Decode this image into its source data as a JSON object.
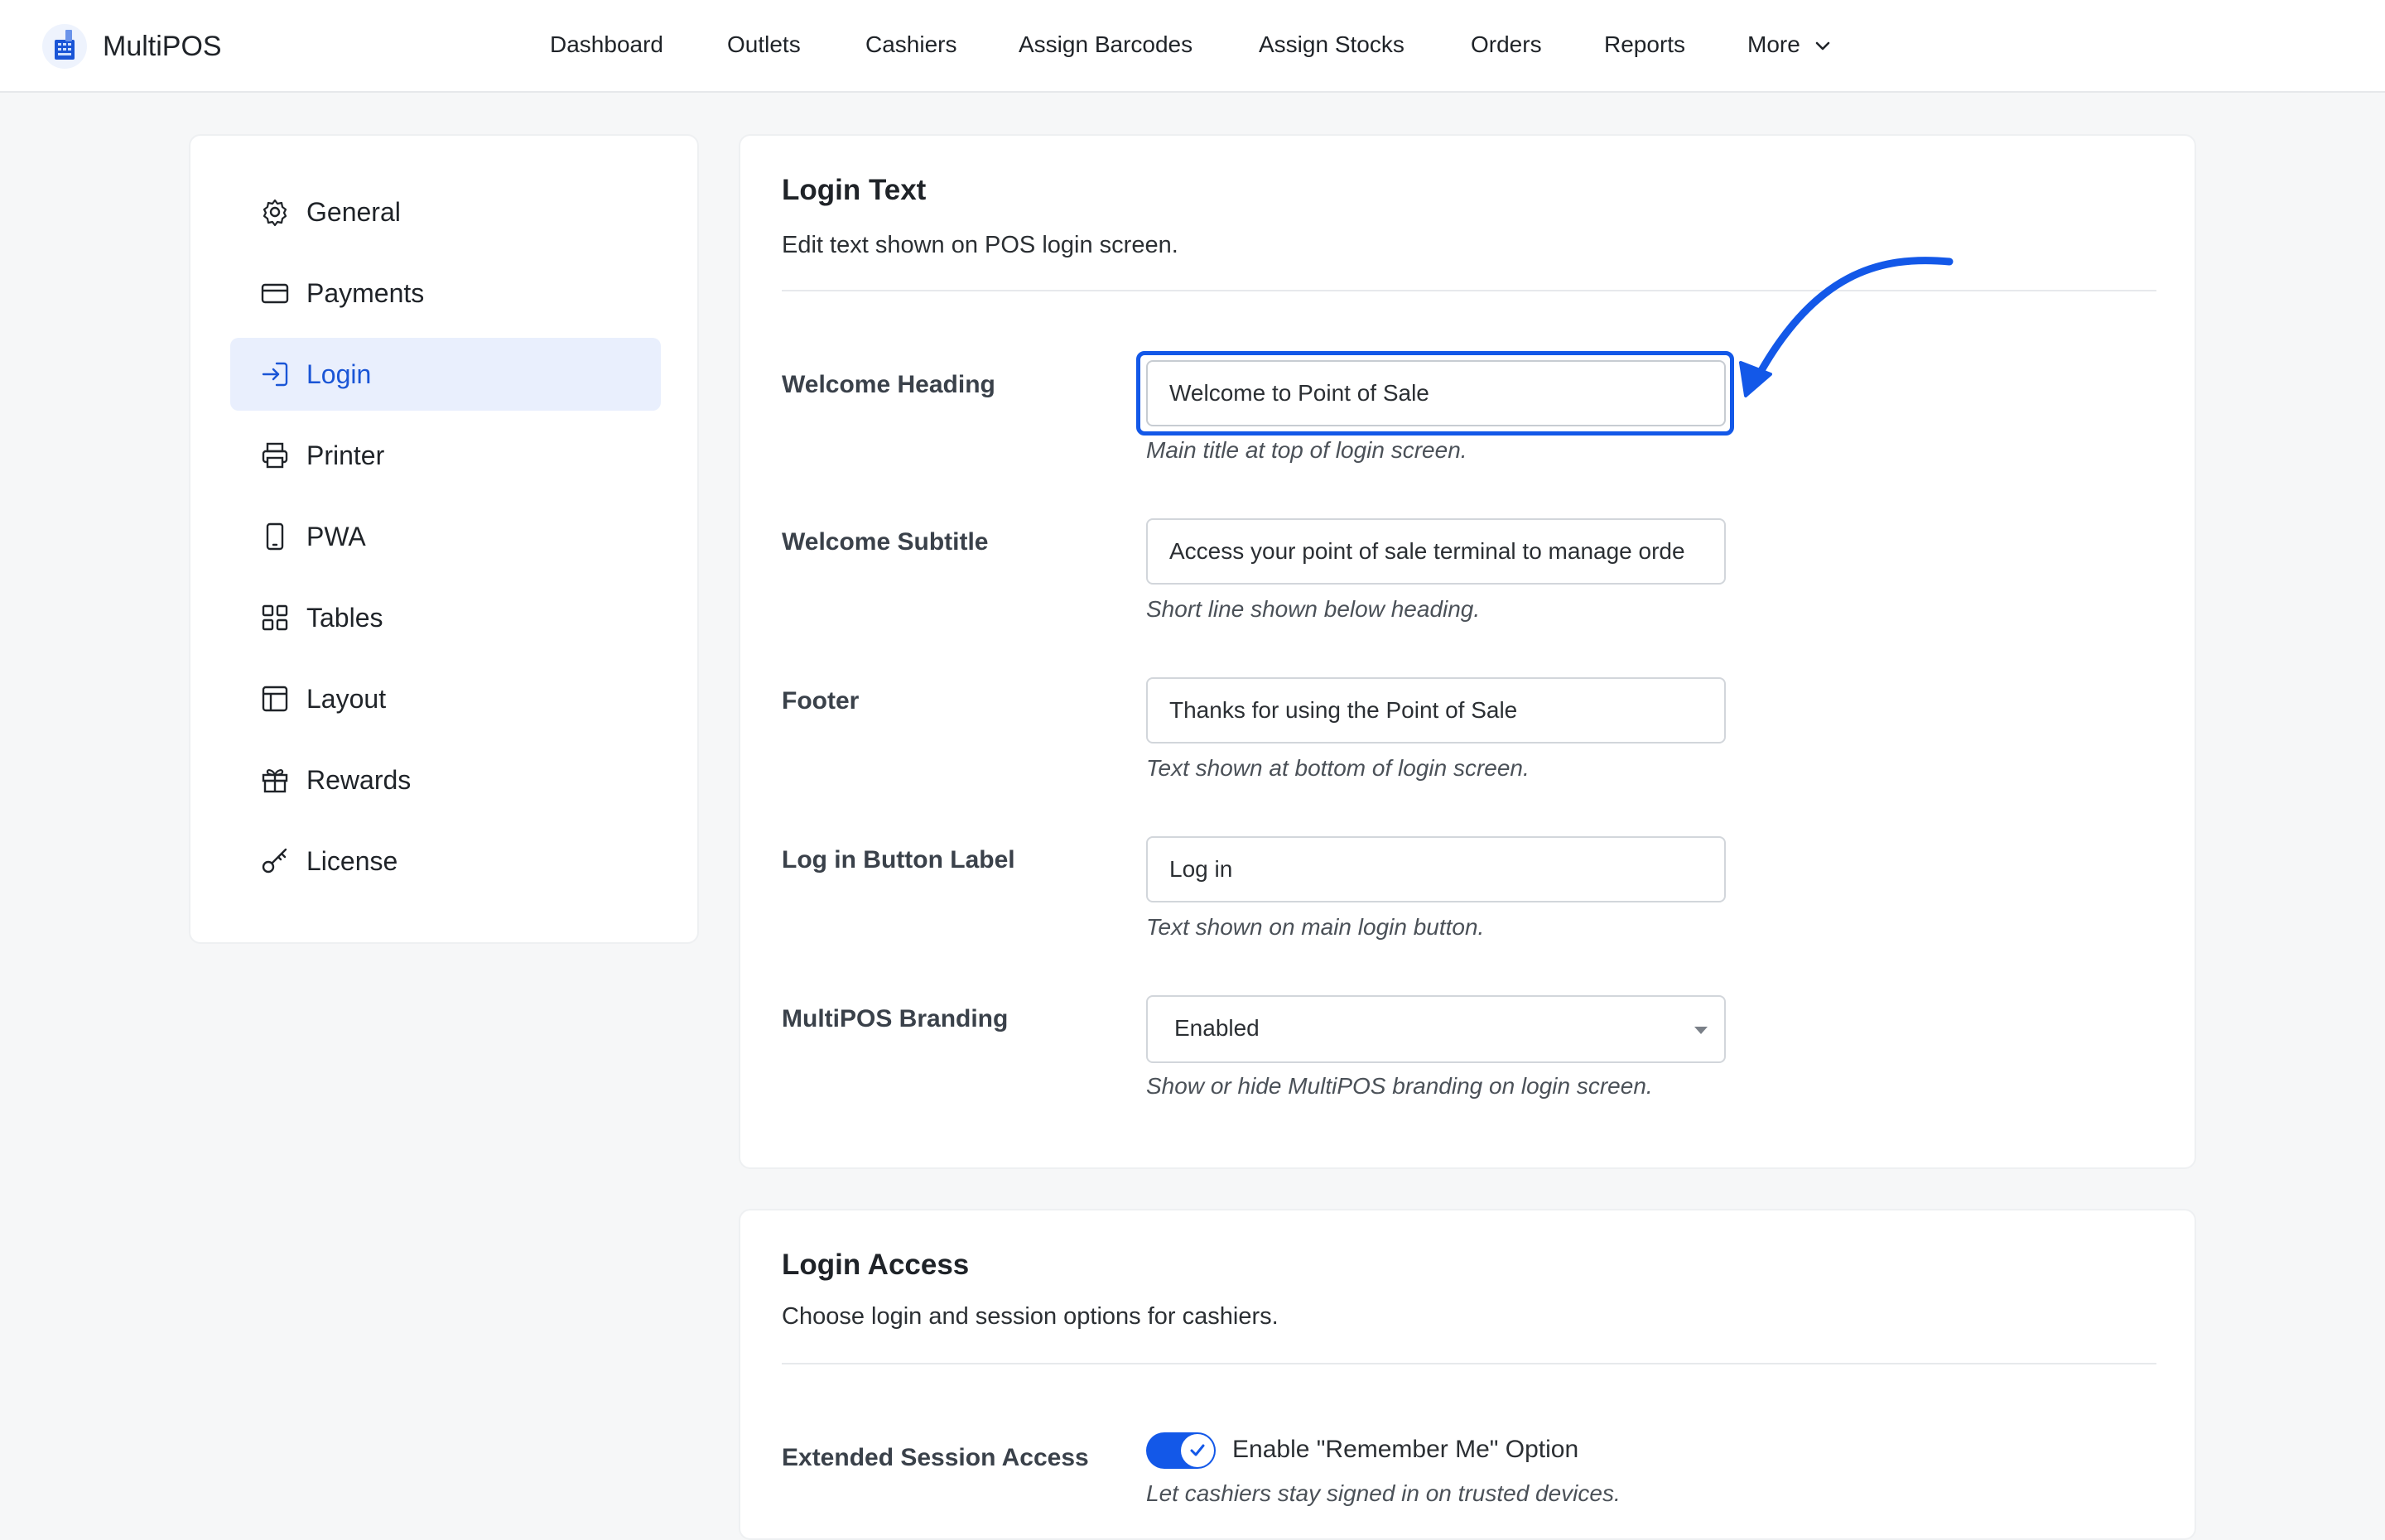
{
  "app": {
    "name": "MultiPOS"
  },
  "nav": {
    "items": [
      "Dashboard",
      "Outlets",
      "Cashiers",
      "Assign Barcodes",
      "Assign Stocks",
      "Orders",
      "Reports",
      "More"
    ]
  },
  "sidebar": {
    "items": [
      {
        "label": "General",
        "icon": "gear-icon"
      },
      {
        "label": "Payments",
        "icon": "credit-card-icon"
      },
      {
        "label": "Login",
        "icon": "login-icon",
        "active": true
      },
      {
        "label": "Printer",
        "icon": "printer-icon"
      },
      {
        "label": "PWA",
        "icon": "mobile-device-icon"
      },
      {
        "label": "Tables",
        "icon": "grid-icon"
      },
      {
        "label": "Layout",
        "icon": "layout-icon"
      },
      {
        "label": "Rewards",
        "icon": "gift-icon"
      },
      {
        "label": "License",
        "icon": "key-icon"
      }
    ]
  },
  "login_text": {
    "title": "Login Text",
    "description": "Edit text shown on POS login screen.",
    "fields": [
      {
        "label": "Welcome Heading",
        "value": "Welcome to Point of Sale",
        "help": "Main title at top of login screen."
      },
      {
        "label": "Welcome Subtitle",
        "value": "Access your point of sale terminal to manage orde",
        "help": "Short line shown below heading."
      },
      {
        "label": "Footer",
        "value": "Thanks for using the Point of Sale",
        "help": "Text shown at bottom of login screen."
      },
      {
        "label": "Log in Button Label",
        "value": "Log in",
        "help": "Text shown on main login button."
      }
    ],
    "branding": {
      "label": "MultiPOS Branding",
      "value": "Enabled",
      "help": "Show or hide MultiPOS branding on login screen."
    }
  },
  "login_access": {
    "title": "Login Access",
    "description": "Choose login and session options for cashiers.",
    "extended_session": {
      "label": "Extended Session Access",
      "toggle_label": "Enable \"Remember Me\" Option",
      "help": "Let cashiers stay signed in on trusted devices.",
      "enabled": true
    }
  },
  "colors": {
    "accent": "#1358e8",
    "active_bg": "#e9effd",
    "active_text": "#1a55d6"
  }
}
